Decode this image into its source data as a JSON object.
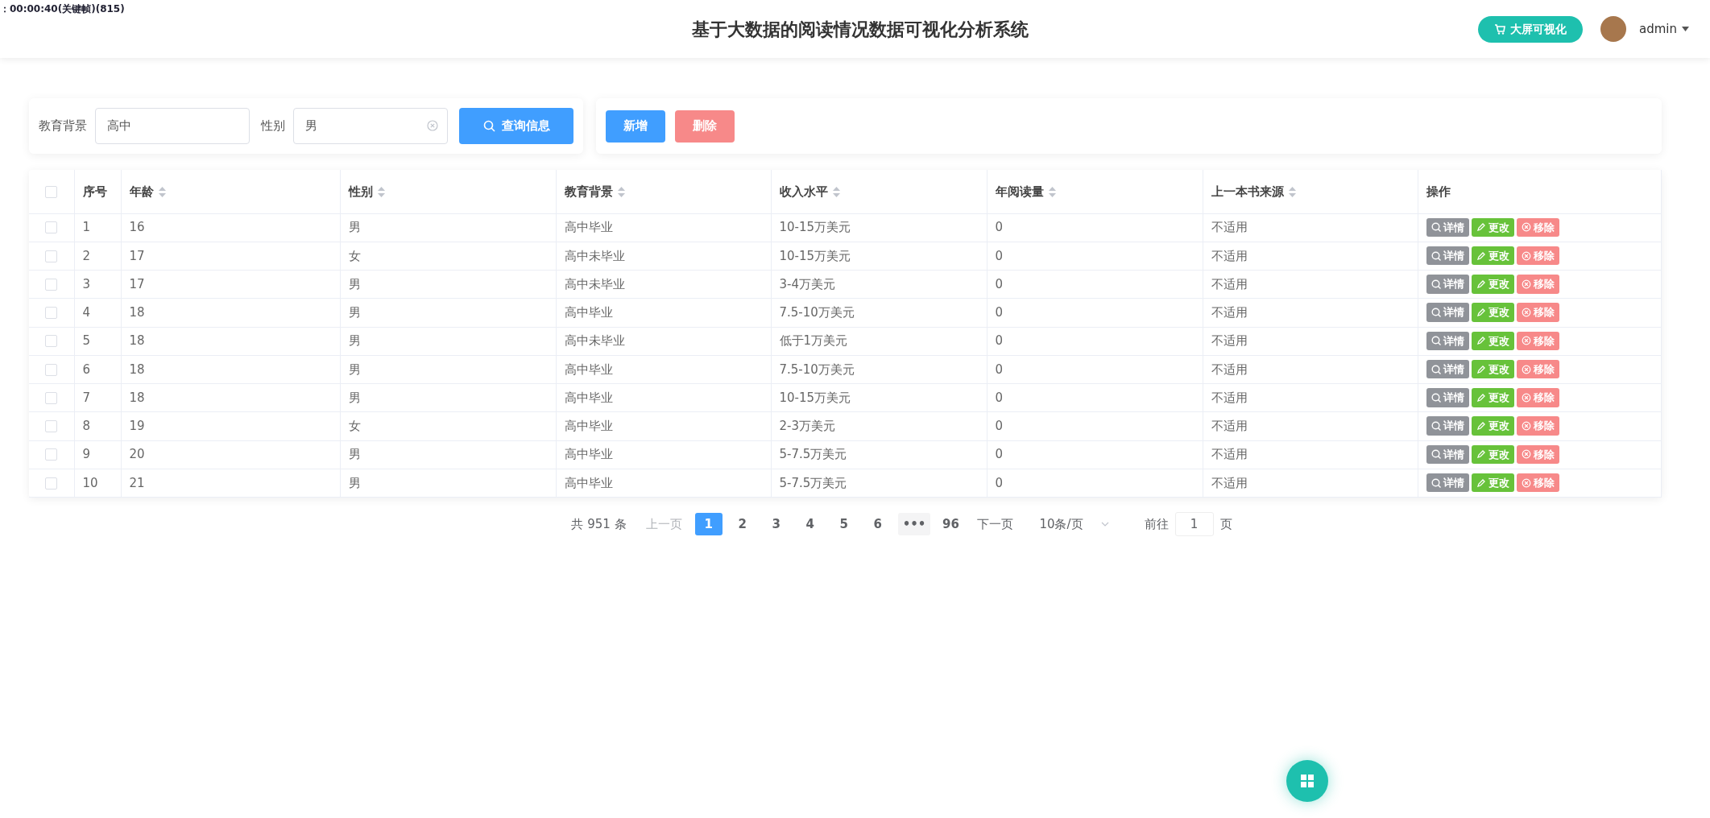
{
  "recording_overlay": "：00:00:40(关键帧)(815)",
  "header": {
    "title": "基于大数据的阅读情况数据可视化分析系统",
    "screen_button": "大屏可视化",
    "user": "admin"
  },
  "search": {
    "fields": [
      {
        "label": "教育背景",
        "value": "高中",
        "clearable": false
      },
      {
        "label": "性别",
        "value": "男",
        "clearable": true
      }
    ],
    "button": "查询信息"
  },
  "actions": [
    {
      "label": "新增",
      "kind": "primary"
    },
    {
      "label": "删除",
      "kind": "danger"
    }
  ],
  "table": {
    "select_all_checked": false,
    "columns": [
      {
        "label": "序号",
        "sortable": false
      },
      {
        "label": "年龄",
        "sortable": true
      },
      {
        "label": "性别",
        "sortable": true
      },
      {
        "label": "教育背景",
        "sortable": true
      },
      {
        "label": "收入水平",
        "sortable": true
      },
      {
        "label": "年阅读量",
        "sortable": true
      },
      {
        "label": "上一本书来源",
        "sortable": true
      },
      {
        "label": "操作",
        "sortable": false
      }
    ],
    "rows": [
      {
        "checked": false,
        "cells": [
          "1",
          "16",
          "男",
          "高中毕业",
          "10-15万美元",
          "0",
          "不适用"
        ],
        "buttons": [
          {
            "label": "详情",
            "kind": "detail"
          },
          {
            "label": "更改",
            "kind": "edit"
          },
          {
            "label": "移除",
            "kind": "remove"
          }
        ]
      },
      {
        "checked": false,
        "cells": [
          "2",
          "17",
          "女",
          "高中未毕业",
          "10-15万美元",
          "0",
          "不适用"
        ],
        "buttons": [
          {
            "label": "详情",
            "kind": "detail"
          },
          {
            "label": "更改",
            "kind": "edit"
          },
          {
            "label": "移除",
            "kind": "remove"
          }
        ]
      },
      {
        "checked": false,
        "cells": [
          "3",
          "17",
          "男",
          "高中未毕业",
          "3-4万美元",
          "0",
          "不适用"
        ],
        "buttons": [
          {
            "label": "详情",
            "kind": "detail"
          },
          {
            "label": "更改",
            "kind": "edit"
          },
          {
            "label": "移除",
            "kind": "remove"
          }
        ]
      },
      {
        "checked": false,
        "cells": [
          "4",
          "18",
          "男",
          "高中毕业",
          "7.5-10万美元",
          "0",
          "不适用"
        ],
        "buttons": [
          {
            "label": "详情",
            "kind": "detail"
          },
          {
            "label": "更改",
            "kind": "edit"
          },
          {
            "label": "移除",
            "kind": "remove"
          }
        ]
      },
      {
        "checked": false,
        "cells": [
          "5",
          "18",
          "男",
          "高中未毕业",
          "低于1万美元",
          "0",
          "不适用"
        ],
        "buttons": [
          {
            "label": "详情",
            "kind": "detail"
          },
          {
            "label": "更改",
            "kind": "edit"
          },
          {
            "label": "移除",
            "kind": "remove"
          }
        ]
      },
      {
        "checked": false,
        "cells": [
          "6",
          "18",
          "男",
          "高中毕业",
          "7.5-10万美元",
          "0",
          "不适用"
        ],
        "buttons": [
          {
            "label": "详情",
            "kind": "detail"
          },
          {
            "label": "更改",
            "kind": "edit"
          },
          {
            "label": "移除",
            "kind": "remove"
          }
        ]
      },
      {
        "checked": false,
        "cells": [
          "7",
          "18",
          "男",
          "高中毕业",
          "10-15万美元",
          "0",
          "不适用"
        ],
        "buttons": [
          {
            "label": "详情",
            "kind": "detail"
          },
          {
            "label": "更改",
            "kind": "edit"
          },
          {
            "label": "移除",
            "kind": "remove"
          }
        ]
      },
      {
        "checked": false,
        "cells": [
          "8",
          "19",
          "女",
          "高中毕业",
          "2-3万美元",
          "0",
          "不适用"
        ],
        "buttons": [
          {
            "label": "详情",
            "kind": "detail"
          },
          {
            "label": "更改",
            "kind": "edit"
          },
          {
            "label": "移除",
            "kind": "remove"
          }
        ]
      },
      {
        "checked": false,
        "cells": [
          "9",
          "20",
          "男",
          "高中毕业",
          "5-7.5万美元",
          "0",
          "不适用"
        ],
        "buttons": [
          {
            "label": "详情",
            "kind": "detail"
          },
          {
            "label": "更改",
            "kind": "edit"
          },
          {
            "label": "移除",
            "kind": "remove"
          }
        ]
      },
      {
        "checked": false,
        "cells": [
          "10",
          "21",
          "男",
          "高中毕业",
          "5-7.5万美元",
          "0",
          "不适用"
        ],
        "buttons": [
          {
            "label": "详情",
            "kind": "detail"
          },
          {
            "label": "更改",
            "kind": "edit"
          },
          {
            "label": "移除",
            "kind": "remove"
          }
        ]
      }
    ]
  },
  "pagination": {
    "total": "共 951 条",
    "prev": {
      "label": "上一页",
      "disabled": true
    },
    "pages": [
      {
        "label": "1",
        "kind": "page",
        "selected": true
      },
      {
        "label": "2",
        "kind": "page",
        "selected": false
      },
      {
        "label": "3",
        "kind": "page",
        "selected": false
      },
      {
        "label": "4",
        "kind": "page",
        "selected": false
      },
      {
        "label": "5",
        "kind": "page",
        "selected": false
      },
      {
        "label": "6",
        "kind": "page",
        "selected": false
      },
      {
        "label": "•••",
        "kind": "more",
        "selected": false
      },
      {
        "label": "96",
        "kind": "page",
        "selected": false
      }
    ],
    "next": {
      "label": "下一页",
      "disabled": false
    },
    "page_size": "10条/页",
    "goto_label": "前往",
    "goto_value": "1",
    "goto_suffix": "页"
  }
}
